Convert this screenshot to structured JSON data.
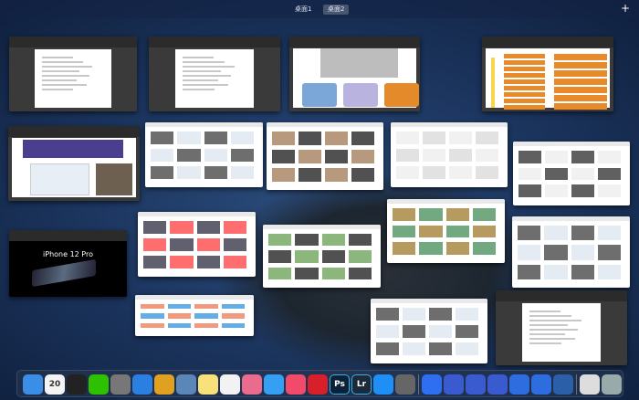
{
  "spaces": [
    {
      "label": "桌面1",
      "active": false
    },
    {
      "label": "桌面2",
      "active": true
    }
  ],
  "add_space_label": "+",
  "windows": [
    {
      "kind": "word"
    },
    {
      "kind": "word"
    },
    {
      "kind": "ppt-list"
    },
    {
      "kind": "ppt-orange"
    },
    {
      "kind": "ppt-purple"
    },
    {
      "kind": "web"
    },
    {
      "kind": "web-media"
    },
    {
      "kind": "web-gray"
    },
    {
      "kind": "web-watches"
    },
    {
      "kind": "apple",
      "headline": "iPhone 12 Pro"
    },
    {
      "kind": "web-video"
    },
    {
      "kind": "web-dark"
    },
    {
      "kind": "web-green"
    },
    {
      "kind": "web"
    },
    {
      "kind": "web-colorful"
    },
    {
      "kind": "web"
    },
    {
      "kind": "word"
    }
  ],
  "dock": [
    {
      "name": "finder",
      "color": "#3a8ee6"
    },
    {
      "name": "calendar",
      "color": "#f4f4f4",
      "text": "20"
    },
    {
      "name": "qq",
      "color": "#222"
    },
    {
      "name": "wechat",
      "color": "#2dc100"
    },
    {
      "name": "launchpad",
      "color": "#777"
    },
    {
      "name": "safari",
      "color": "#2a7fe0"
    },
    {
      "name": "chrome",
      "color": "#e0a020"
    },
    {
      "name": "preview",
      "color": "#5b86b8"
    },
    {
      "name": "notes",
      "color": "#f8e07a"
    },
    {
      "name": "reminders",
      "color": "#f2f2f2"
    },
    {
      "name": "photos",
      "color": "#e96b8d"
    },
    {
      "name": "messages",
      "color": "#35a0f2"
    },
    {
      "name": "music",
      "color": "#f24a6a"
    },
    {
      "name": "netease-music",
      "color": "#d8202a"
    },
    {
      "name": "photoshop",
      "color": "#0b2238",
      "text": "Ps"
    },
    {
      "name": "lightroom",
      "color": "#1c2a3a",
      "text": "Lr"
    },
    {
      "name": "app-store",
      "color": "#1f8ff5"
    },
    {
      "name": "system-preferences",
      "color": "#666"
    },
    {
      "name": "wps",
      "color": "#2d6ff0"
    },
    {
      "name": "ppt-doc-1",
      "color": "#3a5bd0"
    },
    {
      "name": "ppt-doc-2",
      "color": "#3a5bd0"
    },
    {
      "name": "ppt-doc-3",
      "color": "#3a5bd0"
    },
    {
      "name": "word-doc-1",
      "color": "#2e6de0"
    },
    {
      "name": "word-doc-2",
      "color": "#2e6de0"
    },
    {
      "name": "quicktime",
      "color": "#2b5fa8"
    },
    {
      "name": "screen-window",
      "color": "#ddd"
    },
    {
      "name": "trash",
      "color": "#9aa"
    }
  ]
}
